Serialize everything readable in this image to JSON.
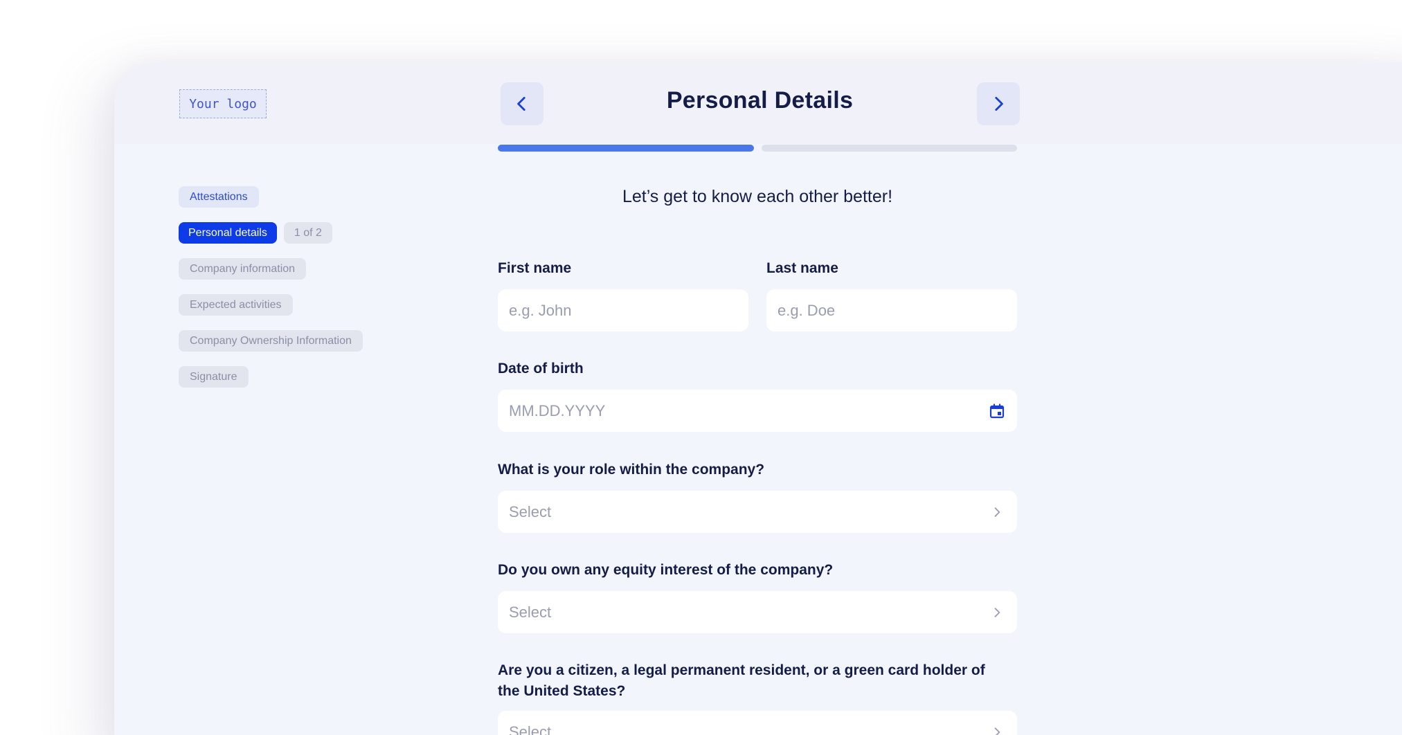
{
  "logo": {
    "text": "Your logo"
  },
  "header": {
    "title": "Personal Details"
  },
  "progress": {
    "step": 1,
    "total_steps": 2
  },
  "steps": [
    {
      "label": "Attestations",
      "state": "done"
    },
    {
      "label": "Personal details",
      "state": "active",
      "counter": "1 of 2"
    },
    {
      "label": "Company information",
      "state": "pending"
    },
    {
      "label": "Expected activities",
      "state": "pending"
    },
    {
      "label": "Company Ownership Information",
      "state": "pending"
    },
    {
      "label": "Signature",
      "state": "pending"
    }
  ],
  "form": {
    "greeting": "Let’s get to know each other better!",
    "first_name": {
      "label": "First name",
      "placeholder": "e.g. John",
      "value": ""
    },
    "last_name": {
      "label": "Last name",
      "placeholder": "e.g. Doe",
      "value": ""
    },
    "dob": {
      "label": "Date of birth",
      "placeholder": "MM.DD.YYYY",
      "value": ""
    },
    "role": {
      "label": "What is your role within the company?",
      "value": "Select"
    },
    "equity": {
      "label": "Do you own any equity interest of the company?",
      "value": "Select"
    },
    "citizenship": {
      "label": "Are you a citizen, a legal permanent resident, or a green card holder of the United States?",
      "value": "Select"
    }
  },
  "colors": {
    "accent": "#0e3be8",
    "progress_fill": "#4a78ec",
    "title_text": "#141c47",
    "background": "#f3f5fc"
  },
  "icons": {
    "back": "chevron-left-icon",
    "next": "chevron-right-icon",
    "calendar": "calendar-icon",
    "select_arrow": "chevron-right-icon"
  }
}
